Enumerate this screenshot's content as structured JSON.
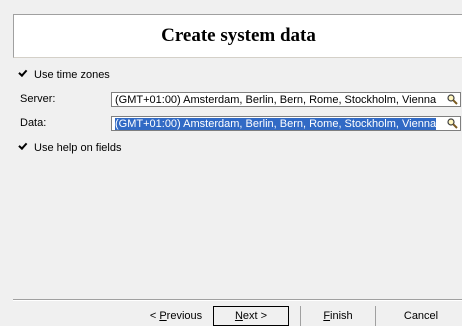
{
  "header": {
    "title": "Create system data"
  },
  "options": {
    "use_time_zones_label": "Use time zones",
    "use_time_zones_checked": true,
    "use_help_label": "Use help on fields",
    "use_help_checked": true
  },
  "server": {
    "label": "Server:",
    "value": "(GMT+01:00) Amsterdam, Berlin, Bern, Rome, Stockholm, Vienna",
    "search_icon": "search-icon"
  },
  "data": {
    "label": "Data:",
    "value": "(GMT+01:00) Amsterdam, Berlin, Bern, Rome, Stockholm, Vienna",
    "selected": true,
    "search_icon": "search-icon"
  },
  "buttons": {
    "previous_prefix": "< ",
    "previous_accel": "P",
    "previous_rest": "revious",
    "next_accel": "N",
    "next_rest": "ext >",
    "finish_accel": "F",
    "finish_rest": "inish",
    "cancel": "Cancel"
  },
  "colors": {
    "selection": "#316ac5",
    "background": "#f0f0f0"
  }
}
